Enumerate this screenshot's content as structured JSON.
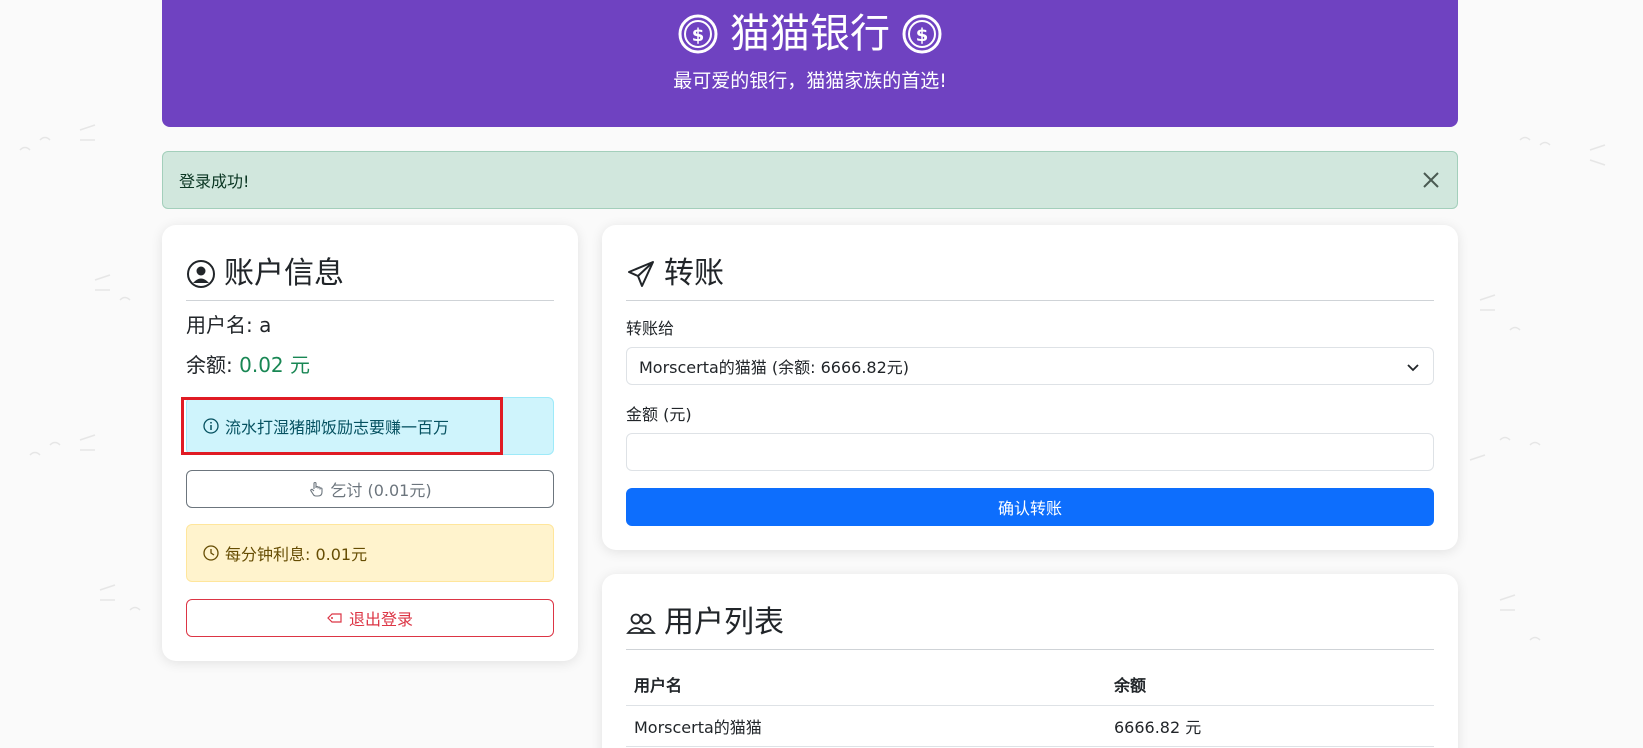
{
  "header": {
    "title": "猫猫银行",
    "subtitle": "最可爱的银行，猫猫家族的首选!",
    "icon": "dollar-coin-icon"
  },
  "alert": {
    "message": "登录成功!",
    "close_icon": "close-icon"
  },
  "account": {
    "heading": "账户信息",
    "heading_icon": "user-circle-icon",
    "username_label": "用户名:",
    "username_value": "a",
    "balance_label": "余额:",
    "balance_value": "0.02 元",
    "tip_text": "流水打湿猪脚饭励志要赚一百万",
    "tip_icon": "info-circle-icon",
    "beg_button": "乞讨 (0.01元)",
    "beg_icon": "hand-pointer-icon",
    "interest_text": "每分钟利息: 0.01元",
    "interest_icon": "clock-icon",
    "logout_button": "退出登录",
    "logout_icon": "tag-icon"
  },
  "transfer": {
    "heading": "转账",
    "heading_icon": "send-icon",
    "recipient_label": "转账给",
    "recipient_selected": "Morscerta的猫猫 (余额: 6666.82元)",
    "amount_label": "金额 (元)",
    "amount_value": "",
    "confirm_button": "确认转账"
  },
  "users": {
    "heading": "用户列表",
    "heading_icon": "people-icon",
    "columns": [
      "用户名",
      "余额"
    ],
    "rows": [
      [
        "Morscerta的猫猫",
        "6666.82 元"
      ]
    ]
  },
  "colors": {
    "header_bg": "#6f42c1",
    "success_bg": "#d1e7dd",
    "info_bg": "#cff4fc",
    "warning_bg": "#fff3cd",
    "primary": "#0d6efd",
    "danger": "#dc3545",
    "balance_green": "#198754",
    "highlight_red": "#e01b24"
  }
}
